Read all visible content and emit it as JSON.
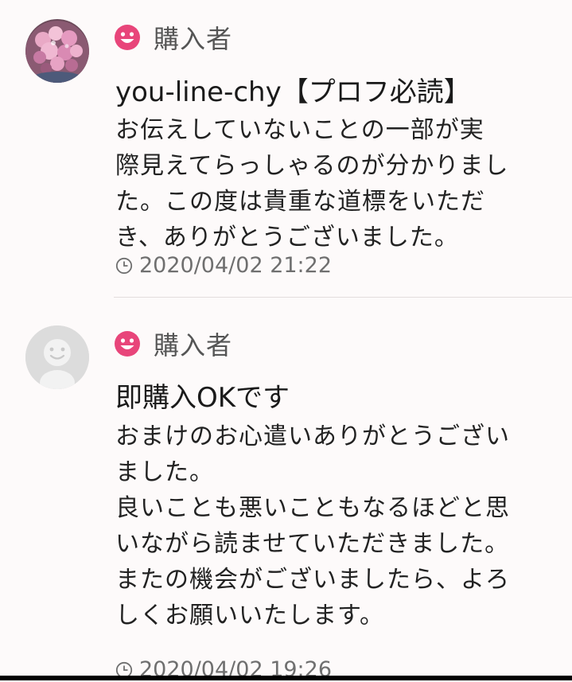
{
  "reviews": [
    {
      "role_icon": "smile-icon",
      "role": "購入者",
      "title": "you-line-chy【プロフ必読】",
      "body": "お伝えしていないことの一部が実\n際見えてらっしゃるのが分かりまし\nた。この度は貴重な道標をいただ\nき、ありがとうございました。",
      "timestamp": "2020/04/02 21:22",
      "avatar": "flower-photo-avatar"
    },
    {
      "role_icon": "smile-icon",
      "role": "購入者",
      "title": "即購入OKです",
      "body": "おまけのお心遣いありがとうござい\nました。\n良いことも悪いこともなるほどと思\nいながら読ませていただきました。\nまたの機会がございましたら、よろ\nしくお願いいたします。",
      "timestamp": "2020/04/02 19:26",
      "avatar": "default-user-avatar"
    }
  ],
  "colors": {
    "accent_pink": "#e8457a",
    "text_secondary": "#6f6f6f",
    "divider": "#e3dede",
    "background": "#fdfafa"
  }
}
